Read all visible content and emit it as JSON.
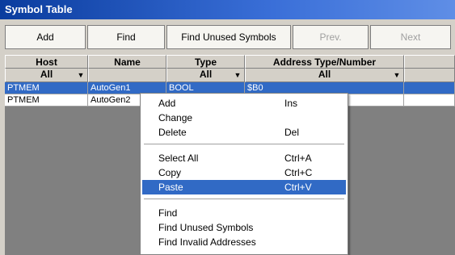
{
  "window": {
    "title": "Symbol Table"
  },
  "toolbar": {
    "add": "Add",
    "find": "Find",
    "find_unused": "Find Unused Symbols",
    "prev": "Prev.",
    "next": "Next"
  },
  "grid": {
    "headers": [
      "Host",
      "Name",
      "Type",
      "Address Type/Number"
    ],
    "filters": [
      "All",
      "",
      "All",
      "All"
    ],
    "rows": [
      {
        "host": "PTMEM",
        "name": "AutoGen1",
        "type": "BOOL",
        "address": "$B0",
        "selected": true
      },
      {
        "host": "PTMEM",
        "name": "AutoGen2",
        "type": "",
        "address": "",
        "selected": false
      }
    ]
  },
  "context_menu": {
    "items": [
      {
        "label": "Add",
        "shortcut": "Ins"
      },
      {
        "label": "Change",
        "shortcut": ""
      },
      {
        "label": "Delete",
        "shortcut": "Del"
      },
      {
        "label": "Select All",
        "shortcut": "Ctrl+A"
      },
      {
        "label": "Copy",
        "shortcut": "Ctrl+C"
      },
      {
        "label": "Paste",
        "shortcut": "Ctrl+V",
        "highlighted": true
      },
      {
        "label": "Find",
        "shortcut": ""
      },
      {
        "label": "Find Unused Symbols",
        "shortcut": ""
      },
      {
        "label": "Find Invalid Addresses",
        "shortcut": ""
      }
    ]
  },
  "colors": {
    "title_bar": "#0a3c9e",
    "selection": "#316ac5",
    "chrome": "#d4d0c8"
  }
}
